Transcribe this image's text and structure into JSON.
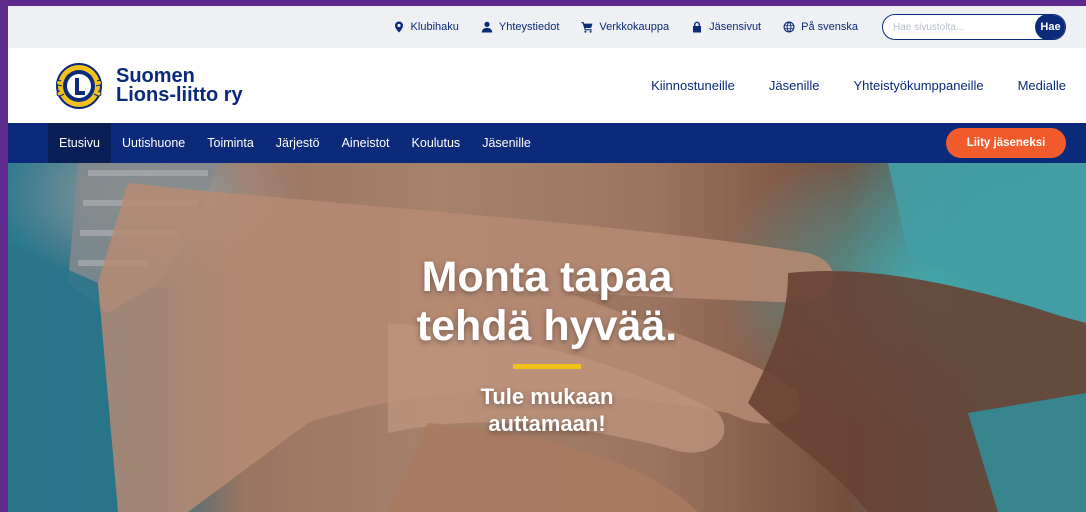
{
  "utility_bar": {
    "links": [
      {
        "label": "Klubihaku",
        "icon": "location-pin-icon"
      },
      {
        "label": "Yhteystiedot",
        "icon": "user-icon"
      },
      {
        "label": "Verkkokauppa",
        "icon": "cart-icon"
      },
      {
        "label": "Jäsensivut",
        "icon": "lock-icon"
      },
      {
        "label": "På svenska",
        "icon": "globe-icon"
      }
    ],
    "search": {
      "placeholder": "Hae sivustolta...",
      "button_label": "Hae"
    }
  },
  "header": {
    "logo_line1": "Suomen",
    "logo_line2": "Lions-liitto ry",
    "nav": [
      "Kiinnostuneille",
      "Jäsenille",
      "Yhteistyökumppaneille",
      "Medialle"
    ]
  },
  "primary_nav": {
    "items": [
      "Etusivu",
      "Uutishuone",
      "Toiminta",
      "Järjestö",
      "Aineistot",
      "Koulutus",
      "Jäsenille"
    ],
    "active": "Etusivu",
    "cta_label": "Liity jäseneksi"
  },
  "hero": {
    "title": "Monta tapaa tehdä hyvää.",
    "subtitle": "Tule mukaan auttamaan!"
  },
  "colors": {
    "brand_blue": "#0b2a7a",
    "cta_orange": "#f15a2b",
    "accent_yellow": "#f2c21b",
    "utility_bg": "#eef0f4"
  }
}
